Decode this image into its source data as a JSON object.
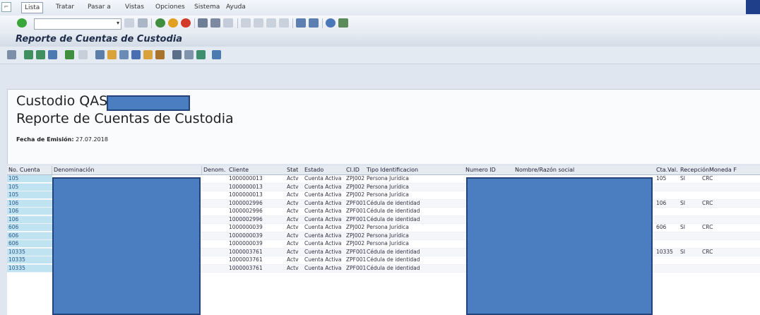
{
  "menubar": {
    "items": [
      "Lista",
      "Tratar",
      "Pasar a",
      "Vistas",
      "Opciones",
      "Sistema",
      "Ayuda"
    ]
  },
  "header": {
    "line1": "Custodio QAS",
    "line2": "Reporte de Cuentas de Custodia",
    "fecha_label": "Fecha de Emisión:",
    "fecha_value": "27.07.2018"
  },
  "title": "Reporte de Cuentas de Custodia",
  "table": {
    "columns": [
      "No. Cuenta",
      "Denominación",
      "Denom.",
      "Cliente",
      "Stat",
      "Estado",
      "Cl.ID",
      "Tipo Identificacion",
      "Numero ID",
      "Nombre/Razón social",
      "Cta.Val.",
      "Recepción",
      "Moneda F"
    ],
    "rows": [
      {
        "cuenta": "105",
        "cliente": "1000000013",
        "stat": "Actv",
        "estado": "Cuenta Activa",
        "clid": "ZPJ002",
        "tipo": "Persona Jurídica",
        "cta": "105",
        "rec": "SI",
        "mon": "CRC"
      },
      {
        "cuenta": "105",
        "cliente": "1000000013",
        "stat": "Actv",
        "estado": "Cuenta Activa",
        "clid": "ZPJ002",
        "tipo": "Persona Jurídica",
        "cta": "",
        "rec": "",
        "mon": ""
      },
      {
        "cuenta": "105",
        "cliente": "1000000013",
        "stat": "Actv",
        "estado": "Cuenta Activa",
        "clid": "ZPJ002",
        "tipo": "Persona Jurídica",
        "cta": "",
        "rec": "",
        "mon": ""
      },
      {
        "cuenta": "106",
        "cliente": "1000002996",
        "stat": "Actv",
        "estado": "Cuenta Activa",
        "clid": "ZPF001",
        "tipo": "Cédula de identidad",
        "cta": "106",
        "rec": "SI",
        "mon": "CRC"
      },
      {
        "cuenta": "106",
        "cliente": "1000002996",
        "stat": "Actv",
        "estado": "Cuenta Activa",
        "clid": "ZPF001",
        "tipo": "Cédula de identidad",
        "cta": "",
        "rec": "",
        "mon": ""
      },
      {
        "cuenta": "106",
        "cliente": "1000002996",
        "stat": "Actv",
        "estado": "Cuenta Activa",
        "clid": "ZPF001",
        "tipo": "Cédula de identidad",
        "cta": "",
        "rec": "",
        "mon": ""
      },
      {
        "cuenta": "606",
        "cliente": "1000000039",
        "stat": "Actv",
        "estado": "Cuenta Activa",
        "clid": "ZPJ002",
        "tipo": "Persona Jurídica",
        "cta": "606",
        "rec": "SI",
        "mon": "CRC"
      },
      {
        "cuenta": "606",
        "cliente": "1000000039",
        "stat": "Actv",
        "estado": "Cuenta Activa",
        "clid": "ZPJ002",
        "tipo": "Persona Jurídica",
        "cta": "",
        "rec": "",
        "mon": ""
      },
      {
        "cuenta": "606",
        "cliente": "1000000039",
        "stat": "Actv",
        "estado": "Cuenta Activa",
        "clid": "ZPJ002",
        "tipo": "Persona Jurídica",
        "cta": "",
        "rec": "",
        "mon": ""
      },
      {
        "cuenta": "10335",
        "cliente": "1000003761",
        "stat": "Actv",
        "estado": "Cuenta Activa",
        "clid": "ZPF001",
        "tipo": "Cédula de identidad",
        "cta": "10335",
        "rec": "SI",
        "mon": "CRC"
      },
      {
        "cuenta": "10335",
        "cliente": "1000003761",
        "stat": "Actv",
        "estado": "Cuenta Activa",
        "clid": "ZPF001",
        "tipo": "Cédula de identidad",
        "cta": "",
        "rec": "",
        "mon": ""
      },
      {
        "cuenta": "10335",
        "cliente": "1000003761",
        "stat": "Actv",
        "estado": "Cuenta Activa",
        "clid": "ZPF001",
        "tipo": "Cédula de identidad",
        "cta": "",
        "rec": "",
        "mon": ""
      }
    ]
  },
  "colors": {
    "accent": "#1f3f8a",
    "redaction": "#4a7ec0",
    "key_col": "#bfe3f0"
  }
}
